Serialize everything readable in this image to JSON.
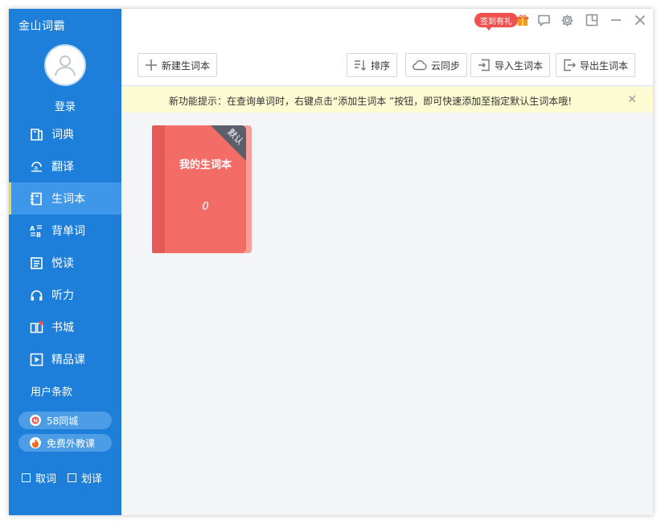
{
  "app": {
    "title": "金山词霸"
  },
  "user": {
    "login_label": "登录"
  },
  "nav": {
    "items": [
      {
        "label": "词典",
        "icon": "dictionary-icon"
      },
      {
        "label": "翻译",
        "icon": "translate-icon"
      },
      {
        "label": "生词本",
        "icon": "vocabulary-book-icon",
        "active": true
      },
      {
        "label": "背单词",
        "icon": "memorize-words-icon"
      },
      {
        "label": "悦读",
        "icon": "reading-icon"
      },
      {
        "label": "听力",
        "icon": "headphones-icon"
      },
      {
        "label": "书城",
        "icon": "bookstore-icon"
      },
      {
        "label": "精品课",
        "icon": "course-play-icon"
      }
    ]
  },
  "sidebar": {
    "terms_label": "用户条款",
    "promos": [
      {
        "label": "58同城",
        "icon": "58-logo-icon"
      },
      {
        "label": "免费外教课",
        "icon": "flame-icon"
      }
    ],
    "checkboxes": [
      {
        "label": "取词",
        "checked": false
      },
      {
        "label": "划译",
        "checked": false
      }
    ]
  },
  "window_controls": {
    "badge_label": "签到有礼",
    "icons": [
      "gift-icon",
      "feedback-icon",
      "settings-icon",
      "mini-mode-icon",
      "minimize-icon",
      "close-icon"
    ]
  },
  "toolbar": {
    "new_label": "新建生词本",
    "sort_label": "排序",
    "sync_label": "云同步",
    "import_label": "导入生词本",
    "export_label": "导出生词本"
  },
  "notice": {
    "text": "新功能提示：在查询单词时，右键点击“添加生词本 ”按钮，即可快速添加至指定默认生词本哦!"
  },
  "books": [
    {
      "title": "我的生词本",
      "count": "0",
      "tag": "默认"
    }
  ],
  "colors": {
    "sidebar": "#1d7fd9",
    "active_item": "#3e97e8",
    "active_marker": "#f7d63b",
    "book_cover": "#f36c66",
    "notice_bg": "#fdfbd2",
    "badge": "#f0514e"
  }
}
